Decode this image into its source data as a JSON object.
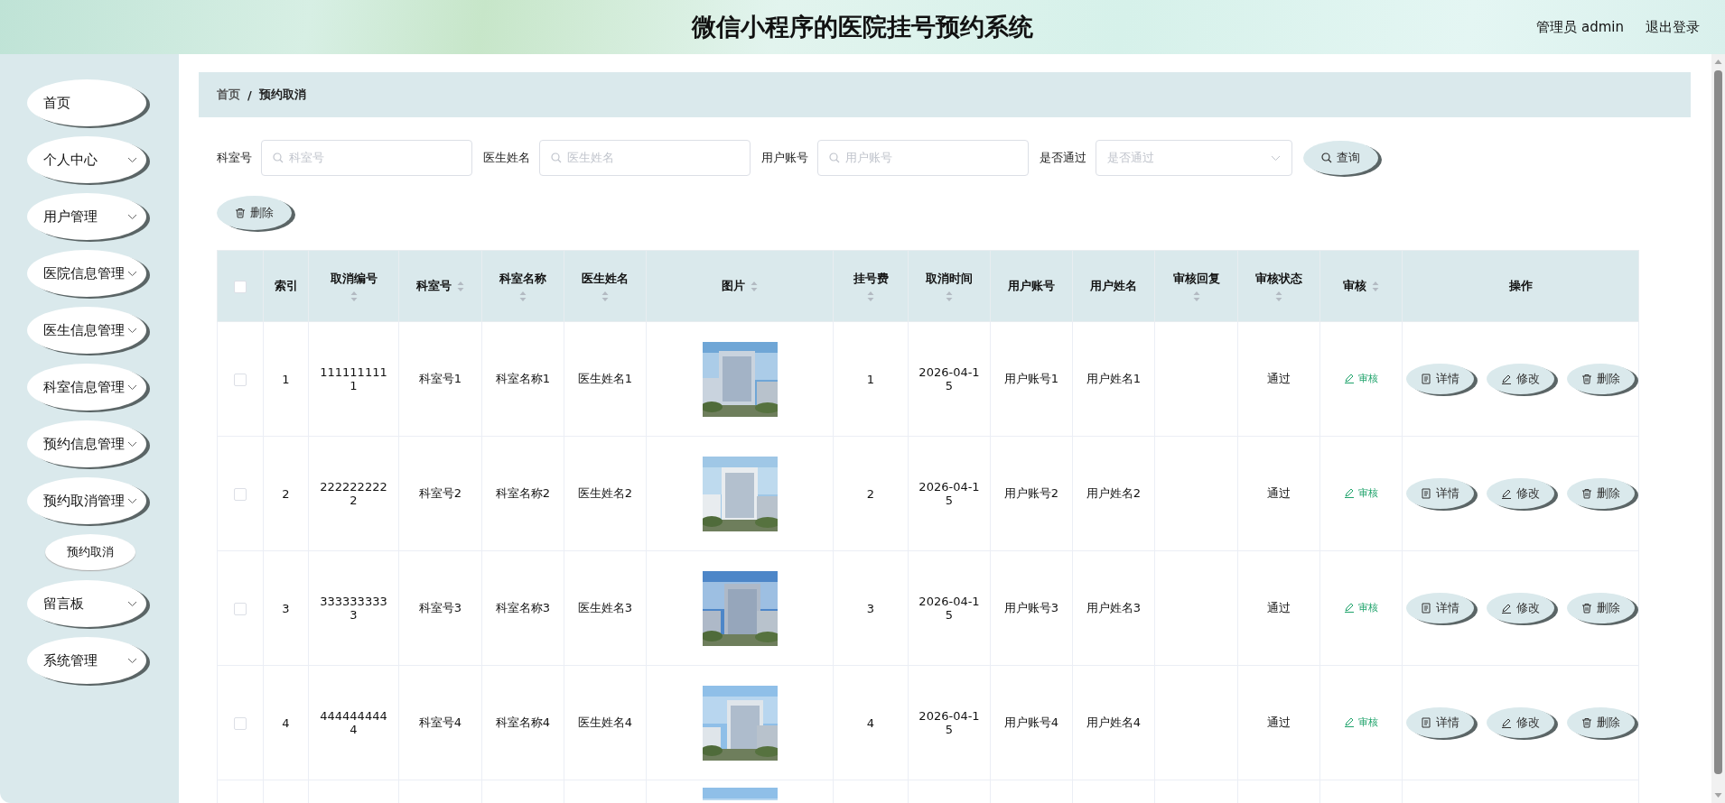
{
  "header": {
    "title": "微信小程序的医院挂号预约系统",
    "user": "管理员 admin",
    "logout": "退出登录"
  },
  "sidebar": {
    "items": [
      {
        "label": "首页",
        "expandable": false
      },
      {
        "label": "个人中心",
        "expandable": true
      },
      {
        "label": "用户管理",
        "expandable": true
      },
      {
        "label": "医院信息管理",
        "expandable": true
      },
      {
        "label": "医生信息管理",
        "expandable": true
      },
      {
        "label": "科室信息管理",
        "expandable": true
      },
      {
        "label": "预约信息管理",
        "expandable": true
      },
      {
        "label": "预约取消管理",
        "expandable": true,
        "children": [
          {
            "label": "预约取消",
            "selected": true
          }
        ]
      },
      {
        "label": "留言板",
        "expandable": true
      },
      {
        "label": "系统管理",
        "expandable": true
      }
    ]
  },
  "breadcrumb": {
    "items": [
      "首页",
      "预约取消"
    ],
    "separator": "/"
  },
  "filters": [
    {
      "kind": "input",
      "label": "科室号",
      "placeholder": "科室号"
    },
    {
      "kind": "input",
      "label": "医生姓名",
      "placeholder": "医生姓名"
    },
    {
      "kind": "input",
      "label": "用户账号",
      "placeholder": "用户账号"
    },
    {
      "kind": "select",
      "label": "是否通过",
      "placeholder": "是否通过"
    }
  ],
  "query_button": "查询",
  "delete_button": "删除",
  "table": {
    "select_all": false,
    "columns": [
      {
        "label": "索引",
        "sortable": false
      },
      {
        "label": "取消编号",
        "sortable": true
      },
      {
        "label": "科室号",
        "sortable": true
      },
      {
        "label": "科室名称",
        "sortable": true
      },
      {
        "label": "医生姓名",
        "sortable": true
      },
      {
        "label": "图片",
        "sortable": true
      },
      {
        "label": "挂号费",
        "sortable": true
      },
      {
        "label": "取消时间",
        "sortable": true
      },
      {
        "label": "用户账号",
        "sortable": false
      },
      {
        "label": "用户姓名",
        "sortable": false
      },
      {
        "label": "审核回复",
        "sortable": true
      },
      {
        "label": "审核状态",
        "sortable": true
      },
      {
        "label": "审核",
        "sortable": true
      },
      {
        "label": "操作",
        "sortable": false
      }
    ],
    "rows": [
      {
        "checked": false,
        "index": "1",
        "cancel_no": "1111111111",
        "dept_no": "科室号1",
        "dept_name": "科室名称1",
        "doctor": "医生姓名1",
        "image": {
          "kind": "picture"
        },
        "fee": "1",
        "cancel_time": "2026-04-15",
        "account": "用户账号1",
        "user_name": "用户姓名1",
        "status": "通过",
        "review": "审核",
        "actions": [
          "详情",
          "修改",
          "删除"
        ]
      },
      {
        "checked": false,
        "index": "2",
        "cancel_no": "2222222222",
        "dept_no": "科室号2",
        "dept_name": "科室名称2",
        "doctor": "医生姓名2",
        "image": {
          "kind": "picture"
        },
        "fee": "2",
        "cancel_time": "2026-04-15",
        "account": "用户账号2",
        "user_name": "用户姓名2",
        "status": "通过",
        "review": "审核",
        "actions": [
          "详情",
          "修改",
          "删除"
        ]
      },
      {
        "checked": false,
        "index": "3",
        "cancel_no": "3333333333",
        "dept_no": "科室号3",
        "dept_name": "科室名称3",
        "doctor": "医生姓名3",
        "image": {
          "kind": "picture"
        },
        "fee": "3",
        "cancel_time": "2026-04-15",
        "account": "用户账号3",
        "user_name": "用户姓名3",
        "status": "通过",
        "review": "审核",
        "actions": [
          "详情",
          "修改",
          "删除"
        ]
      },
      {
        "checked": false,
        "index": "4",
        "cancel_no": "4444444444",
        "dept_no": "科室号4",
        "dept_name": "科室名称4",
        "doctor": "医生姓名4",
        "image": {
          "kind": "picture"
        },
        "fee": "4",
        "cancel_time": "2026-04-15",
        "account": "用户账号4",
        "user_name": "用户姓名4",
        "status": "通过",
        "review": "审核",
        "actions": [
          "详情",
          "修改",
          "删除"
        ]
      }
    ],
    "partial_row": {
      "image": {
        "kind": "picture"
      }
    }
  }
}
